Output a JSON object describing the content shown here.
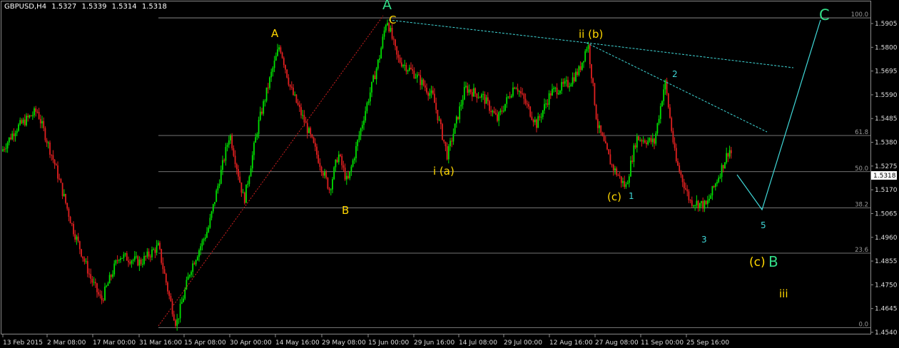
{
  "header": {
    "symbol": "GBPUSD,H4",
    "open": "1.5327",
    "high": "1.5339",
    "low": "1.5314",
    "close": "1.5318"
  },
  "colors": {
    "background": "#000000",
    "bull": "#00e000",
    "bear": "#e02020",
    "grid": "#8a8a8a",
    "fib": "#9a9a9a",
    "cyan": "#40d8d8",
    "yellow": "#ffd700",
    "green_label": "#33dd88"
  },
  "chart_data": {
    "type": "candlestick",
    "title": "GBPUSD,H4",
    "ylim": [
      1.4545,
      1.5955
    ],
    "y_ticks": [
      "1.5905",
      "1.5800",
      "1.5695",
      "1.5590",
      "1.5485",
      "1.5380",
      "1.5275",
      "1.5170",
      "1.5065",
      "1.4960",
      "1.4855",
      "1.4750",
      "1.4645",
      "1.4540"
    ],
    "current_price": "1.5318",
    "x_ticks": [
      "13 Feb 2015",
      "2 Mar 08:00",
      "17 Mar 00:00",
      "31 Mar 16:00",
      "15 Apr 08:00",
      "30 Apr 00:00",
      "14 May 16:00",
      "29 May 08:00",
      "15 Jun 00:00",
      "29 Jun 16:00",
      "14 Jul 08:00",
      "29 Jul 00:00",
      "12 Aug 16:00",
      "27 Aug 08:00",
      "11 Sep 00:00",
      "25 Sep 16:00"
    ],
    "fib_levels": [
      {
        "label": "100.0",
        "price": 1.593
      },
      {
        "label": "61.8",
        "price": 1.541
      },
      {
        "label": "50.0",
        "price": 1.525
      },
      {
        "label": "38.2",
        "price": 1.509
      },
      {
        "label": "23.6",
        "price": 1.489
      },
      {
        "label": "0.0",
        "price": 1.456
      }
    ],
    "price_path": [
      {
        "t": 0,
        "p": 1.534
      },
      {
        "t": 20,
        "p": 1.544
      },
      {
        "t": 50,
        "p": 1.552
      },
      {
        "t": 75,
        "p": 1.528
      },
      {
        "t": 100,
        "p": 1.5
      },
      {
        "t": 125,
        "p": 1.478
      },
      {
        "t": 140,
        "p": 1.468
      },
      {
        "t": 165,
        "p": 1.488
      },
      {
        "t": 195,
        "p": 1.485
      },
      {
        "t": 220,
        "p": 1.492
      },
      {
        "t": 235,
        "p": 1.47
      },
      {
        "t": 245,
        "p": 1.4575
      },
      {
        "t": 265,
        "p": 1.482
      },
      {
        "t": 290,
        "p": 1.5
      },
      {
        "t": 320,
        "p": 1.542
      },
      {
        "t": 340,
        "p": 1.512
      },
      {
        "t": 360,
        "p": 1.546
      },
      {
        "t": 378,
        "p": 1.568
      },
      {
        "t": 390,
        "p": 1.581
      },
      {
        "t": 405,
        "p": 1.562
      },
      {
        "t": 430,
        "p": 1.543
      },
      {
        "t": 460,
        "p": 1.517
      },
      {
        "t": 472,
        "p": 1.533
      },
      {
        "t": 485,
        "p": 1.52
      },
      {
        "t": 510,
        "p": 1.552
      },
      {
        "t": 530,
        "p": 1.576
      },
      {
        "t": 540,
        "p": 1.593
      },
      {
        "t": 555,
        "p": 1.575
      },
      {
        "t": 580,
        "p": 1.568
      },
      {
        "t": 605,
        "p": 1.558
      },
      {
        "t": 625,
        "p": 1.532
      },
      {
        "t": 650,
        "p": 1.562
      },
      {
        "t": 675,
        "p": 1.558
      },
      {
        "t": 695,
        "p": 1.548
      },
      {
        "t": 720,
        "p": 1.564
      },
      {
        "t": 750,
        "p": 1.546
      },
      {
        "t": 770,
        "p": 1.56
      },
      {
        "t": 795,
        "p": 1.564
      },
      {
        "t": 810,
        "p": 1.57
      },
      {
        "t": 822,
        "p": 1.582
      },
      {
        "t": 835,
        "p": 1.546
      },
      {
        "t": 855,
        "p": 1.528
      },
      {
        "t": 875,
        "p": 1.518
      },
      {
        "t": 890,
        "p": 1.54
      },
      {
        "t": 915,
        "p": 1.538
      },
      {
        "t": 930,
        "p": 1.565
      },
      {
        "t": 945,
        "p": 1.53
      },
      {
        "t": 965,
        "p": 1.512
      },
      {
        "t": 988,
        "p": 1.51
      },
      {
        "t": 1005,
        "p": 1.523
      },
      {
        "t": 1020,
        "p": 1.535
      },
      {
        "t": 1025,
        "p": 1.5318
      }
    ]
  },
  "annotations": {
    "wave_A_big": "A",
    "wave_C_small": "C",
    "wave_A_yellow": "A",
    "wave_B_yellow": "B",
    "wave_ii_b": "ii (b)",
    "wave_i_a": "i (a)",
    "wave_c_yellow": "(c)",
    "wave_1": "1",
    "wave_2": "2",
    "wave_3": "3",
    "wave_5": "5",
    "wave_c_B_c": "(c)",
    "wave_c_B_B": "B",
    "wave_C_big": "C",
    "wave_iii": "iii"
  }
}
